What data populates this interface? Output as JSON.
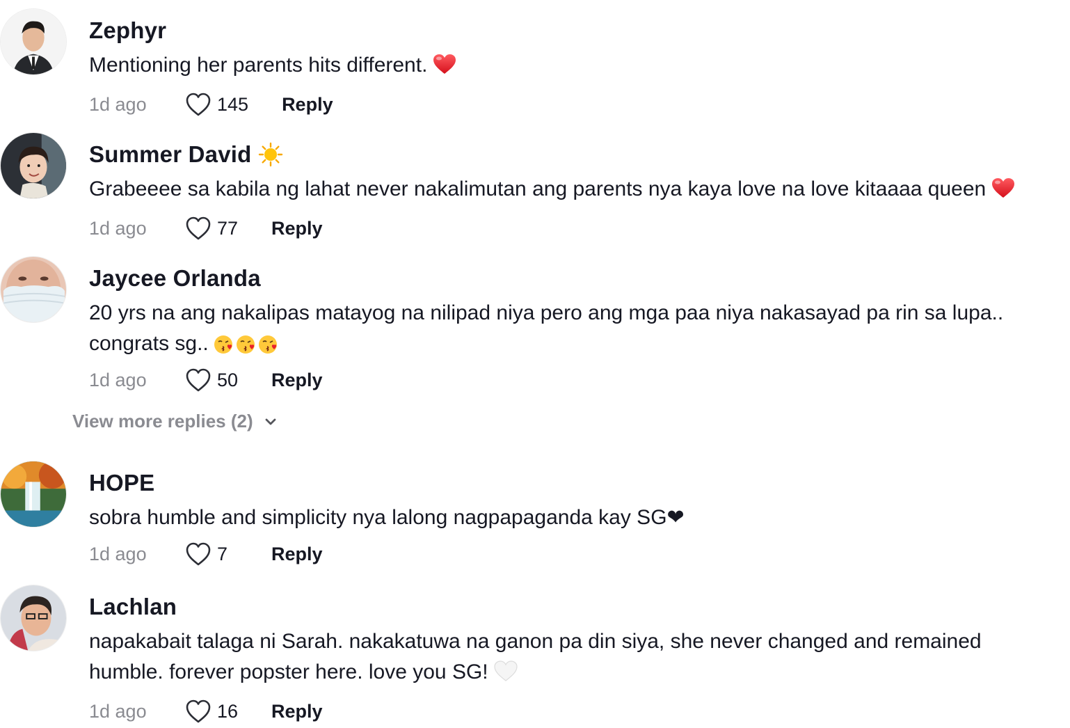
{
  "comments": [
    {
      "username": "Zephyr",
      "text": "Mentioning her parents hits different.",
      "time": "1d ago",
      "likes": "145",
      "reply_label": "Reply",
      "trailing_emoji": "red-heart"
    },
    {
      "username": "Summer David",
      "username_emoji": "sun",
      "text": "Grabeeee sa kabila ng lahat never nakalimutan ang parents nya kaya love na love kitaaaa queen",
      "time": "1d ago",
      "likes": "77",
      "reply_label": "Reply",
      "trailing_emoji": "red-heart"
    },
    {
      "username": "Jaycee Orlanda",
      "text": "20 yrs na ang nakalipas matayog na nilipad niya pero ang mga paa niya nakasayad pa rin sa lupa.. congrats sg..",
      "time": "1d ago",
      "likes": "50",
      "reply_label": "Reply",
      "trailing_emoji": "kissing-face x3"
    },
    {
      "username": "HOPE",
      "text": "sobra humble and simplicity nya lalong nagpapaganda kay SG❤",
      "time": "1d ago",
      "likes": "7",
      "reply_label": "Reply"
    },
    {
      "username": "Lachlan",
      "text": "napakabait talaga ni Sarah. nakakatuwa na ganon pa din siya, she never changed and remained humble. forever popster here. love you SG!",
      "time": "1d ago",
      "likes": "16",
      "reply_label": "Reply",
      "trailing_emoji": "white-heart"
    }
  ],
  "view_more_replies": "View more replies (2)",
  "colors": {
    "text": "#161823",
    "muted": "#8a8b91",
    "heart_red": "#e8202c"
  }
}
